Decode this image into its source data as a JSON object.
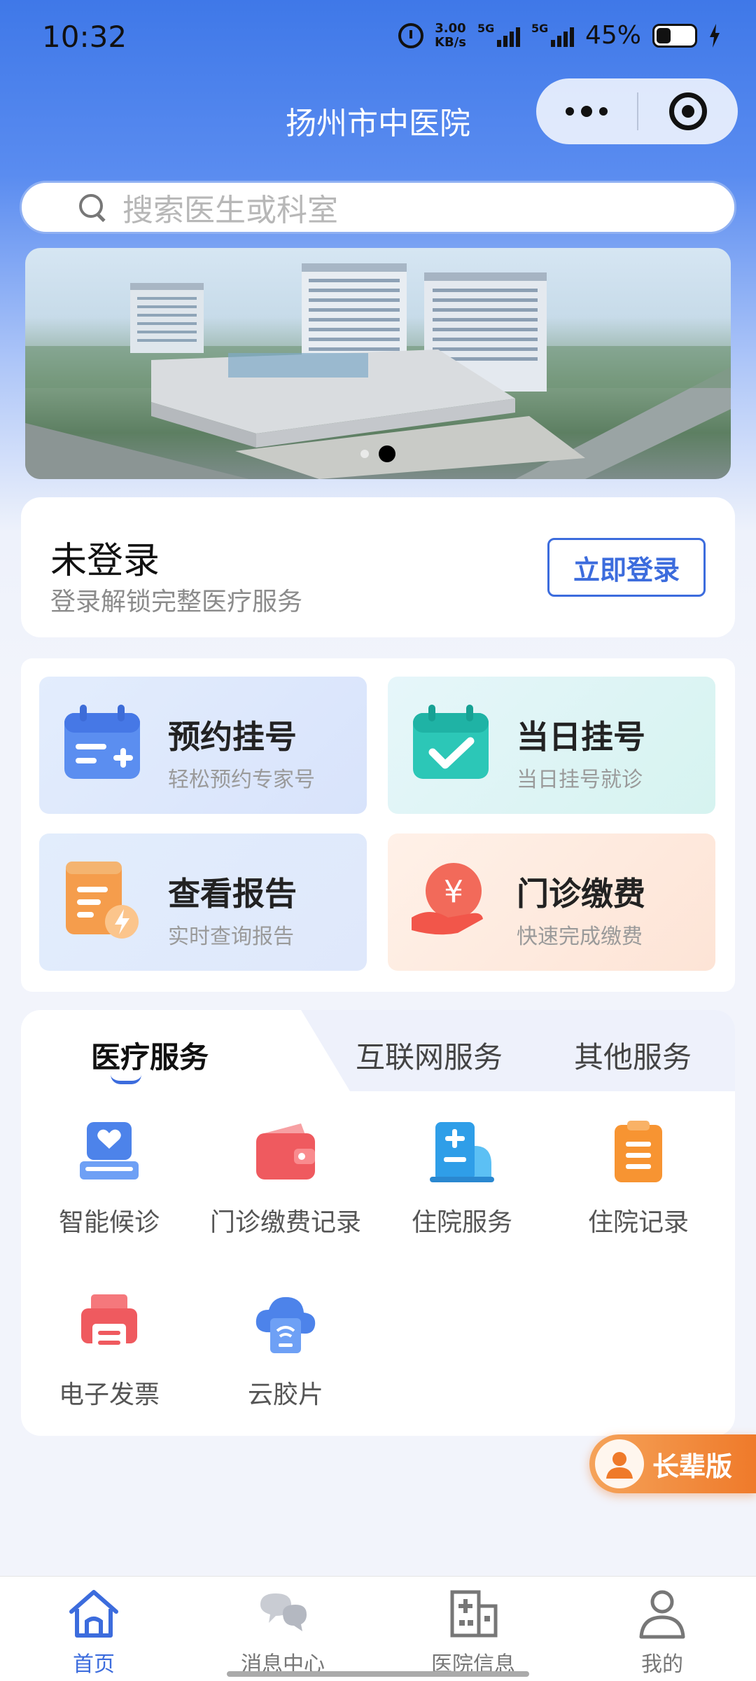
{
  "status_bar": {
    "time": "10:32",
    "net_speed_value": "3.00",
    "net_speed_unit": "KB/s",
    "signal1_label": "5G",
    "signal2_label": "5G",
    "battery": "45%",
    "battery_level": 0.45,
    "icons": [
      "alarm-icon",
      "signal-icon",
      "battery-icon",
      "charging-icon"
    ]
  },
  "header": {
    "title": "扬州市中医院",
    "more_icon": "more-dots-icon",
    "close_icon": "target-icon"
  },
  "search": {
    "placeholder": "搜索医生或科室"
  },
  "banner": {
    "slides": 2,
    "active_slide": 2
  },
  "login": {
    "title": "未登录",
    "subtitle": "登录解锁完整医疗服务",
    "button": "立即登录"
  },
  "quick_actions": [
    {
      "title": "预约挂号",
      "subtitle": "轻松预约专家号",
      "icon": "calendar-plus-icon"
    },
    {
      "title": "当日挂号",
      "subtitle": "当日挂号就诊",
      "icon": "calendar-check-icon"
    },
    {
      "title": "查看报告",
      "subtitle": "实时查询报告",
      "icon": "report-icon"
    },
    {
      "title": "门诊缴费",
      "subtitle": "快速完成缴费",
      "icon": "payment-hand-icon"
    }
  ],
  "service_tabs": {
    "tabs": [
      "医疗服务",
      "互联网服务",
      "其他服务"
    ],
    "active": 0
  },
  "services": [
    {
      "label": "智能候诊",
      "icon": "smart-waiting-icon"
    },
    {
      "label": "门诊缴费记录",
      "icon": "wallet-icon"
    },
    {
      "label": "住院服务",
      "icon": "hospital-bed-icon"
    },
    {
      "label": "住院记录",
      "icon": "clipboard-icon"
    },
    {
      "label": "电子发票",
      "icon": "printer-invoice-icon"
    },
    {
      "label": "云胶片",
      "icon": "cloud-film-icon"
    }
  ],
  "elder_mode": {
    "label": "长辈版",
    "icon": "elder-avatar-icon"
  },
  "bottom_nav": {
    "items": [
      {
        "label": "首页",
        "icon": "home-icon"
      },
      {
        "label": "消息中心",
        "icon": "chat-icon"
      },
      {
        "label": "医院信息",
        "icon": "hospital-building-icon"
      },
      {
        "label": "我的",
        "icon": "user-icon"
      }
    ],
    "active": 0
  },
  "colors": {
    "primary": "#3c6cdd",
    "header_blue": "#3f78e8",
    "elder_orange": "#ef7a2a"
  }
}
